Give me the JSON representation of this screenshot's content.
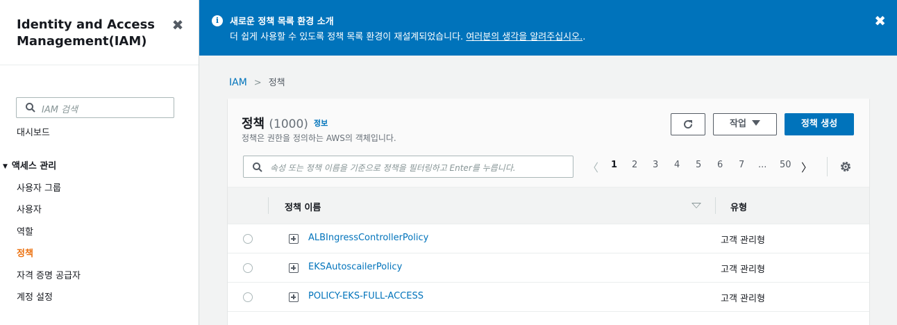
{
  "sidebar": {
    "title_line1": "Identity and Access",
    "title_line2": "Management(IAM)",
    "close": "✖",
    "search_placeholder": "IAM 검색",
    "dashboard": "대시보드",
    "section_access": "액세스 관리",
    "items": [
      {
        "label": "사용자 그룹"
      },
      {
        "label": "사용자"
      },
      {
        "label": "역할"
      },
      {
        "label": "정책"
      },
      {
        "label": "자격 증명 공급자"
      },
      {
        "label": "계정 설정"
      }
    ],
    "active_item": "정책"
  },
  "flash": {
    "title": "새로운 정책 목록 환경 소개",
    "body": "더 쉽게 사용할 수 있도록 정책 목록 환경이 재설계되었습니다. ",
    "link": "여러분의 생각을 알려주십시오.",
    "trail": ".",
    "close": "✖"
  },
  "breadcrumb": {
    "root": "IAM",
    "current": "정책"
  },
  "panel": {
    "title": "정책",
    "count": "(1000)",
    "info": "정보",
    "description": "정책은 권한을 정의하는 AWS의 객체입니다.",
    "refresh_icon": "refresh-icon",
    "action_label": "작업",
    "create_label": "정책 생성",
    "filter_placeholder": "속성 또는 정책 이름을 기준으로 정책을 필터링하고 Enter를 누릅니다."
  },
  "pagination": {
    "prev": "〈",
    "pages": [
      "1",
      "2",
      "3",
      "4",
      "5",
      "6",
      "7",
      "...",
      "50"
    ],
    "current": "1",
    "next": "〉"
  },
  "table": {
    "columns": [
      "정책 이름",
      "유형"
    ],
    "rows": [
      {
        "name": "ALBIngressControllerPolicy",
        "type": "고객 관리형"
      },
      {
        "name": "EKSAutoscailerPolicy",
        "type": "고객 관리형"
      },
      {
        "name": "POLICY-EKS-FULL-ACCESS",
        "type": "고객 관리형"
      }
    ]
  },
  "colors": {
    "accent": "#0073bb",
    "active_nav": "#ec7211"
  }
}
